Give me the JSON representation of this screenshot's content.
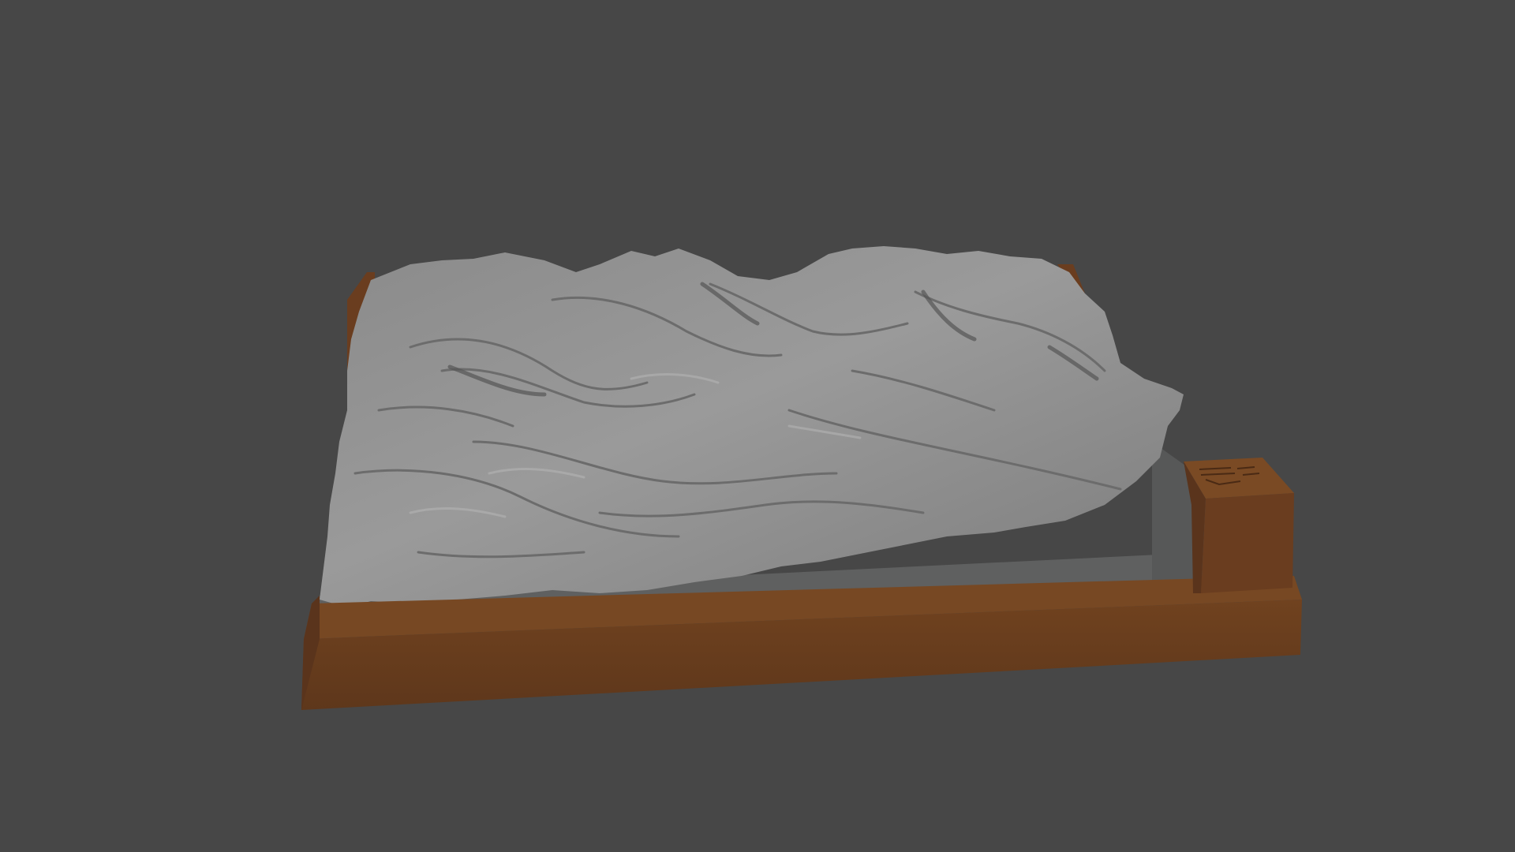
{
  "viewport": {
    "background_color": "#474747"
  },
  "scene": {
    "object": "terrain-relief-model",
    "terrain_color": "#8e8e8e",
    "terrain_side_color": "#5f6060",
    "base_frame_color": "#6b3f22",
    "base_frame_side_color": "#5a341c",
    "label_block_color": "#6b3f22"
  }
}
